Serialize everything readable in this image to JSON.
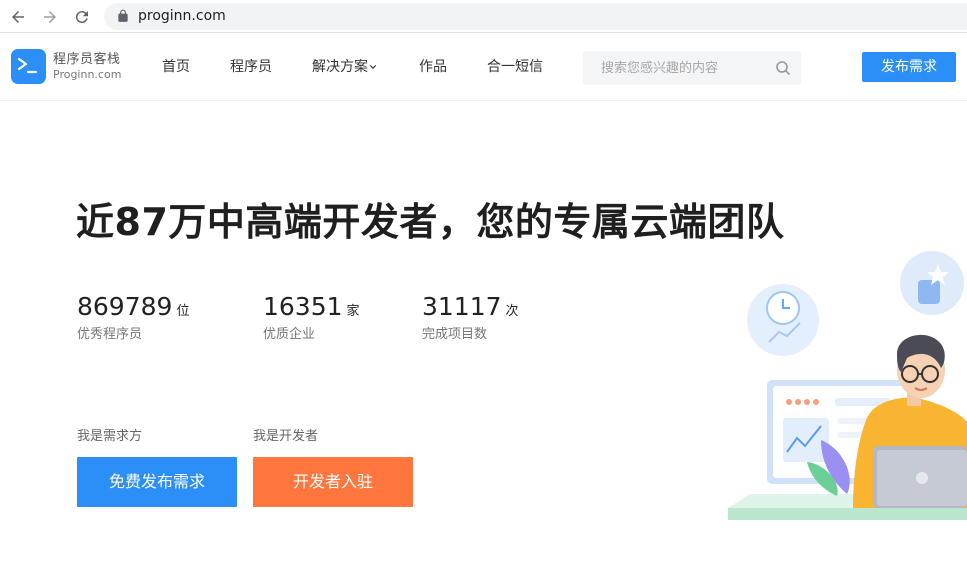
{
  "browser": {
    "url": "proginn.com"
  },
  "header": {
    "logo_title": "程序员客栈",
    "logo_subtitle": "Proginn.com",
    "menu": [
      {
        "label": "首页"
      },
      {
        "label": "程序员"
      },
      {
        "label": "解决方案"
      },
      {
        "label": "作品"
      },
      {
        "label": "合一短信"
      }
    ],
    "search_placeholder": "搜索您感兴趣的内容",
    "publish_label": "发布需求"
  },
  "hero": {
    "title": "近87万中高端开发者，您的专属云端团队",
    "stats": [
      {
        "value": "869789",
        "unit": "位",
        "label": "优秀程序员"
      },
      {
        "value": "16351",
        "unit": "家",
        "label": "优质企业"
      },
      {
        "value": "31117",
        "unit": "次",
        "label": "完成项目数"
      }
    ],
    "client_label": "我是需求方",
    "developer_label": "我是开发者",
    "client_button": "免费发布需求",
    "developer_button": "开发者入驻"
  },
  "colors": {
    "brand_blue": "#2b8ff7",
    "accent_orange": "#ff773e"
  },
  "icons": [
    "back-arrow-icon",
    "forward-arrow-icon",
    "reload-icon",
    "lock-icon",
    "logo-terminal-icon",
    "chevron-down-icon",
    "search-icon",
    "clock-icon",
    "thumbs-up-icon"
  ]
}
